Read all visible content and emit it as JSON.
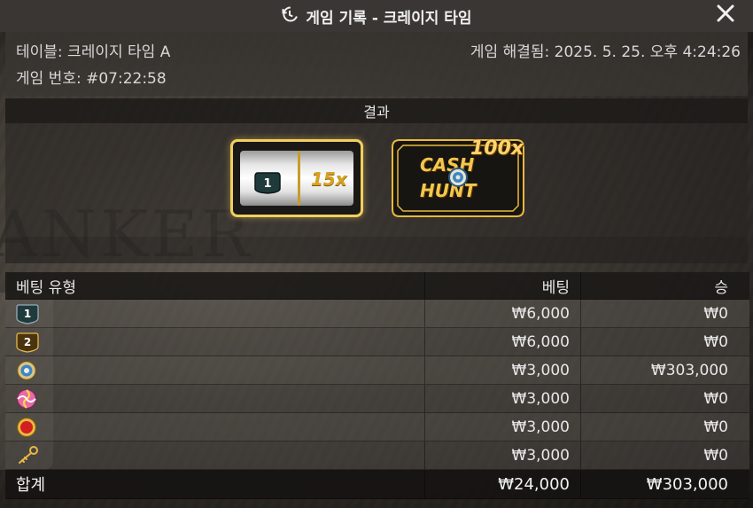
{
  "header": {
    "title": "게임 기록 - 크레이지 타임",
    "history_icon": "history-icon",
    "close_icon": "close-icon"
  },
  "info": {
    "table": "테이블: 크레이지 타임 A",
    "game_number": "게임 번호: #07:22:58",
    "resolved": "게임 해결됨: 2025. 5. 25. 오후 4:24:26"
  },
  "result": {
    "heading": "결과",
    "slot": {
      "segment_icon": "number-1-badge-icon",
      "segment_value": "1",
      "multiplier": "15x"
    },
    "wheel": {
      "multiplier": "100x",
      "line1": "CASH",
      "line2": "HUNT",
      "icon": "target-icon"
    }
  },
  "table": {
    "headers": {
      "type": "베팅 유형",
      "bet": "베팅",
      "win": "승"
    },
    "rows": [
      {
        "icon": "number-1-badge-icon",
        "label": "1",
        "bet": "₩6,000",
        "win": "₩0"
      },
      {
        "icon": "number-2-badge-icon",
        "label": "2",
        "bet": "₩6,000",
        "win": "₩0"
      },
      {
        "icon": "cash-hunt-target-icon",
        "label": "",
        "bet": "₩3,000",
        "win": "₩303,000"
      },
      {
        "icon": "pachinko-candy-icon",
        "label": "",
        "bet": "₩3,000",
        "win": "₩0"
      },
      {
        "icon": "coin-flip-red-icon",
        "label": "",
        "bet": "₩3,000",
        "win": "₩0"
      },
      {
        "icon": "crazy-time-key-icon",
        "label": "",
        "bet": "₩3,000",
        "win": "₩0"
      }
    ],
    "total": {
      "label": "합계",
      "bet": "₩24,000",
      "win": "₩303,000"
    }
  },
  "colors": {
    "gold": "#f2cf5e",
    "panel": "#3a3633"
  }
}
